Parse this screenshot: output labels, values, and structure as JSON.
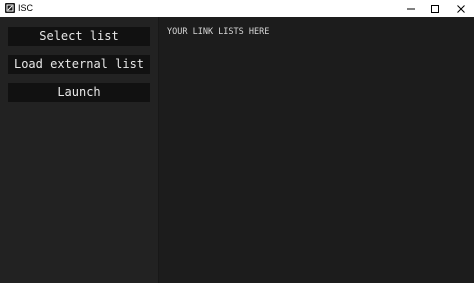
{
  "window": {
    "title": "ISC",
    "icon": "app-icon",
    "controls": [
      "minimize-icon",
      "maximize-icon",
      "close-icon"
    ]
  },
  "sidebar": {
    "buttons": [
      {
        "label": "Select list"
      },
      {
        "label": "Load external list"
      },
      {
        "label": "Launch"
      }
    ]
  },
  "main": {
    "placeholder_text": "YOUR LINK LISTS HERE"
  },
  "colors": {
    "titlebar_bg": "#ffffff",
    "sidebar_bg": "#222222",
    "content_bg": "#1c1c1c",
    "button_bg": "#111111",
    "text": "#e8e8e8"
  }
}
